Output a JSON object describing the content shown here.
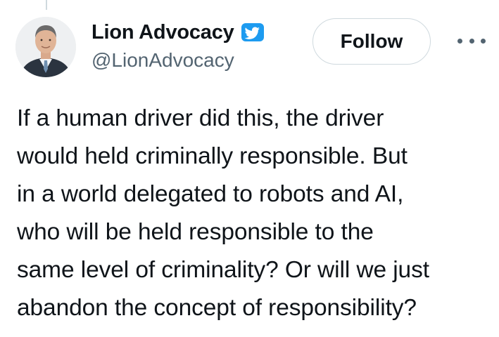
{
  "author": {
    "display_name": "Lion Advocacy",
    "handle": "@LionAdvocacy",
    "verified": true,
    "verified_color": "#1d9bf0"
  },
  "actions": {
    "follow_label": "Follow",
    "more_icon": "more-horizontal-icon"
  },
  "tweet": {
    "lines": [
      "If a human driver did this, the driver",
      "would held criminally responsible. But",
      "in a world delegated to robots and AI,",
      "who will be held responsible to the",
      "same level of criminality? Or will we just",
      "abandon the concept of responsibility?"
    ]
  }
}
